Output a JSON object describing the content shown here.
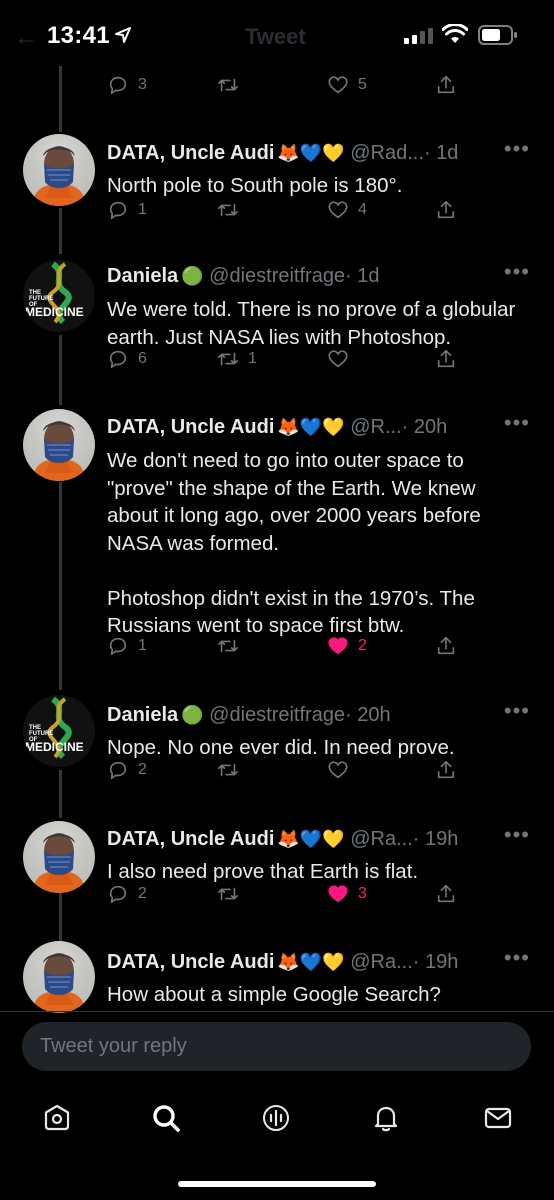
{
  "status_bar": {
    "time": "13:41",
    "faded_title": "Tweet"
  },
  "top_actions": {
    "reply_count": "3",
    "retweet_count": "",
    "like_count": "5"
  },
  "tweets": [
    {
      "name": "DATA, Uncle Audi",
      "emojis": "🦊💙💛",
      "handle": "@Rad...",
      "time": "· 1d",
      "text": "North pole to South pole is 180°.",
      "replies": "1",
      "retweets": "",
      "likes": "4",
      "liked": false
    },
    {
      "name": "Daniela",
      "emojis": "🟢",
      "handle": "@diestreitfrage",
      "time": "· 1d",
      "text": "We were told. There is no prove of a globular earth. Just NASA lies with Photoshop.",
      "replies": "6",
      "retweets": "1",
      "likes": "",
      "liked": false
    },
    {
      "name": "DATA, Uncle Audi",
      "emojis": "🦊💙💛",
      "handle": "@R...",
      "time": "· 20h",
      "text": "We don't need to go into outer space to \"prove\" the shape of the Earth. We knew about it long ago, over 2000 years before NASA was formed.\n\nPhotoshop didn't exist in the 1970’s. The Russians went to space first btw.",
      "replies": "1",
      "retweets": "",
      "likes": "2",
      "liked": true
    },
    {
      "name": "Daniela",
      "emojis": "🟢",
      "handle": "@diestreitfrage",
      "time": "· 20h",
      "text": "Nope. No one ever did. In need prove.",
      "replies": "2",
      "retweets": "",
      "likes": "",
      "liked": false
    },
    {
      "name": "DATA, Uncle Audi",
      "emojis": "🦊💙💛",
      "handle": "@Ra...",
      "time": "· 19h",
      "text": "I also need prove that Earth is flat.",
      "replies": "2",
      "retweets": "",
      "likes": "3",
      "liked": true
    },
    {
      "name": "DATA, Uncle Audi",
      "emojis": "🦊💙💛",
      "handle": "@Ra...",
      "time": "· 19h",
      "text": "How about a simple Google Search?",
      "replies": "",
      "retweets": "",
      "likes": "",
      "liked": false
    }
  ],
  "daniela_avatar": {
    "line1": "THE",
    "line2": "FUTURE",
    "line3": "OF",
    "line4": "MEDICINE"
  },
  "compose": {
    "placeholder": "Tweet your reply"
  },
  "tabbar": [
    "home-icon",
    "search-icon",
    "spaces-icon",
    "notifications-icon",
    "messages-icon"
  ],
  "colors": {
    "background": "#000000",
    "text": "#e7e9ea",
    "muted": "#71767b",
    "like": "#f91880"
  }
}
